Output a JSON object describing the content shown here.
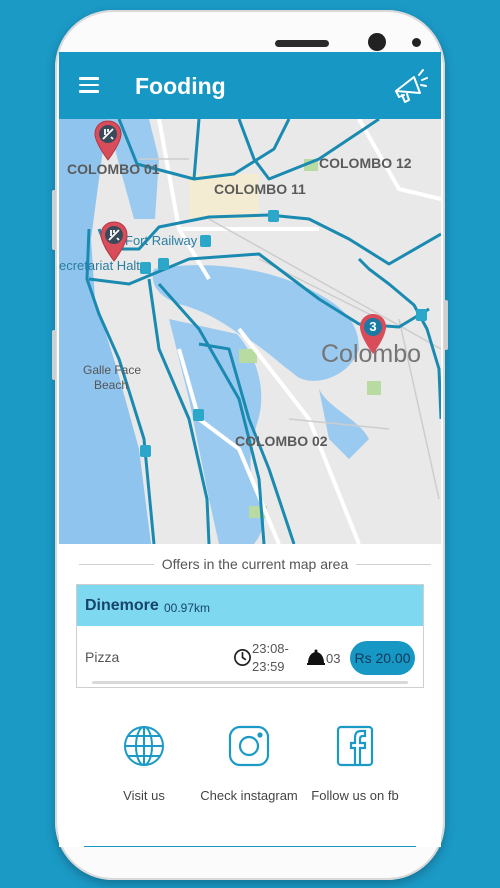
{
  "app": {
    "title": "Fooding"
  },
  "map": {
    "labels": {
      "colombo01": "COLOMBO 01",
      "colombo11": "COLOMBO 11",
      "colombo12": "COLOMBO 12",
      "colombo02": "COLOMBO 02",
      "colombo": "Colombo",
      "fort_railway": "Fort Railway",
      "secretariat_halt": "ecretariat Halt",
      "galle_face_1": "Galle Face",
      "galle_face_2": "Beach"
    },
    "cluster_count": "3"
  },
  "offers": {
    "section_title": "Offers in the current map area",
    "items": [
      {
        "restaurant": "Dinemore",
        "distance": "00.97km",
        "item": "Pizza",
        "time_start": "23:08-",
        "time_end": "23:59",
        "count": "03",
        "price": "Rs 20.00"
      }
    ]
  },
  "social": {
    "visit_label": "Visit us",
    "instagram_label": "Check instagram",
    "facebook_label": "Follow us on fb"
  },
  "colors": {
    "primary": "#1797c4",
    "card_header": "#7ed9f0",
    "background": "#1b9ac6",
    "pin": "#d94c5a"
  }
}
